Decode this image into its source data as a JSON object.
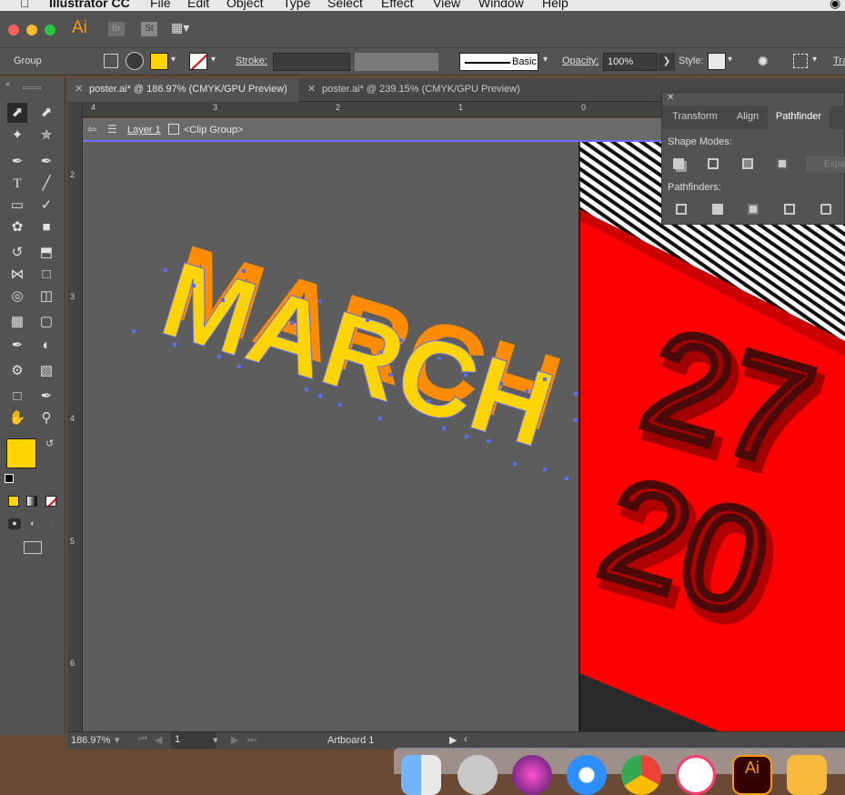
{
  "menubar": {
    "app_name": "Illustrator CC",
    "items": [
      "File",
      "Edit",
      "Object",
      "Type",
      "Select",
      "Effect",
      "View",
      "Window",
      "Help"
    ]
  },
  "appbar": {
    "ai_logo": "Ai",
    "br_logo": "Br",
    "st_logo": "St"
  },
  "control_bar": {
    "selection_label": "Group",
    "fill_color": "#ffd400",
    "stroke_label": "Stroke:",
    "brush_label": "Basic",
    "opacity_label": "Opacity:",
    "opacity_value": "100%",
    "style_label": "Style:",
    "transform_short": "Tra"
  },
  "tabs": [
    {
      "label": "poster.ai* @ 186.97% (CMYK/GPU Preview)",
      "active": true
    },
    {
      "label": "poster.ai* @ 239.15% (CMYK/GPU Preview)",
      "active": false
    }
  ],
  "ruler_top": [
    "4",
    "3",
    "2",
    "1",
    "0"
  ],
  "ruler_left": [
    "2",
    "3",
    "4",
    "5",
    "6"
  ],
  "isolation": {
    "layer": "Layer 1",
    "group": "<Clip Group>"
  },
  "canvas": {
    "headline": "MARCH",
    "day": "27",
    "year": "20"
  },
  "panel": {
    "tabs": [
      "Transform",
      "Align",
      "Pathfinder"
    ],
    "active_tab": "Pathfinder",
    "shape_modes_label": "Shape Modes:",
    "expand_label": "Expa",
    "pathfinders_label": "Pathfinders:"
  },
  "statusbar": {
    "zoom": "186.97%",
    "artboard_number": "1",
    "artboard_name": "Artboard 1"
  },
  "colors": {
    "accent_yellow": "#ffd400",
    "accent_orange": "#ff8c00",
    "poster_red": "#ff0000",
    "selection_blue": "#5a6bff"
  }
}
